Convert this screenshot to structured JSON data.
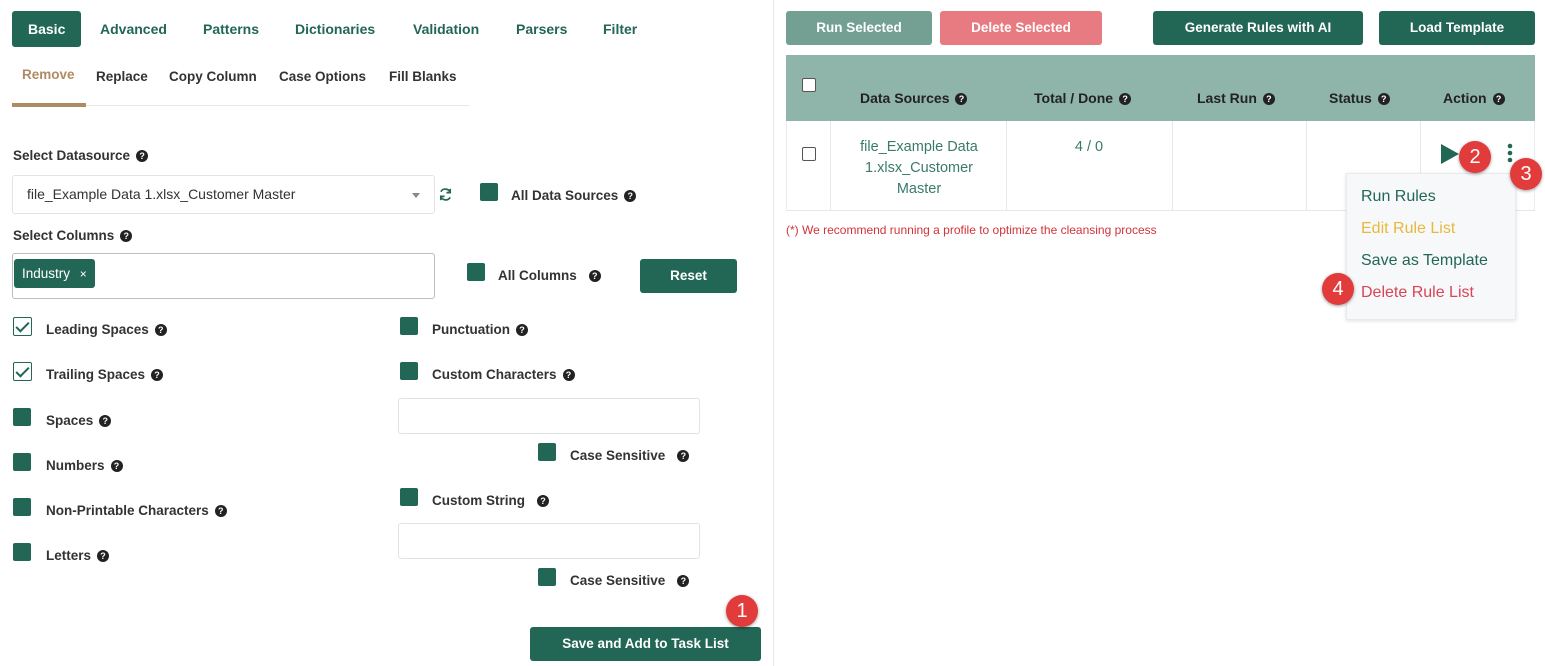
{
  "tabs": [
    "Basic",
    "Advanced",
    "Patterns",
    "Dictionaries",
    "Validation",
    "Parsers",
    "Filter"
  ],
  "subtabs": [
    "Remove",
    "Replace",
    "Copy Column",
    "Case Options",
    "Fill Blanks"
  ],
  "datasource": {
    "label": "Select Datasource",
    "value": "file_Example Data 1.xlsx_Customer Master",
    "all_sources_label": "All Data Sources"
  },
  "columns": {
    "label": "Select Columns",
    "tag": "Industry",
    "all_columns_label": "All Columns",
    "reset_label": "Reset"
  },
  "options_left": [
    {
      "label": "Leading Spaces",
      "checked": true
    },
    {
      "label": "Trailing Spaces",
      "checked": true
    },
    {
      "label": "Spaces",
      "checked": false
    },
    {
      "label": "Numbers",
      "checked": false
    },
    {
      "label": "Non-Printable Characters",
      "checked": false
    },
    {
      "label": "Letters",
      "checked": false
    }
  ],
  "options_right": {
    "punctuation": "Punctuation",
    "custom_characters": "Custom Characters",
    "case_sensitive_1": "Case Sensitive",
    "custom_string": "Custom String",
    "case_sensitive_2": "Case Sensitive"
  },
  "save_label": "Save and Add to Task List",
  "toolbar": {
    "run_selected": "Run Selected",
    "delete_selected": "Delete Selected",
    "generate_ai": "Generate Rules with AI",
    "load_template": "Load Template"
  },
  "table": {
    "headers": [
      "Data Sources",
      "Total / Done",
      "Last Run",
      "Status",
      "Action"
    ],
    "row": {
      "data_source_lines": [
        "file_Example Data",
        "1.xlsx_Customer",
        "Master"
      ],
      "total_done": "4 / 0",
      "last_run": "",
      "status": ""
    }
  },
  "note": "(*) We recommend running a profile to optimize the cleansing process",
  "menu": [
    "Run Rules",
    "Edit Rule List",
    "Save as Template",
    "Delete Rule List"
  ],
  "badges": [
    "1",
    "2",
    "3",
    "4"
  ],
  "colors": {
    "primary": "#226655",
    "header_bg": "#8fb4aa",
    "run_selected_bg": "#73a093",
    "delete_selected_bg": "#e87a82",
    "edit_rule": "#e6b93a",
    "delete_rule": "#d94456",
    "note_red": "#d0343a",
    "badge_red": "#e23b3b"
  }
}
